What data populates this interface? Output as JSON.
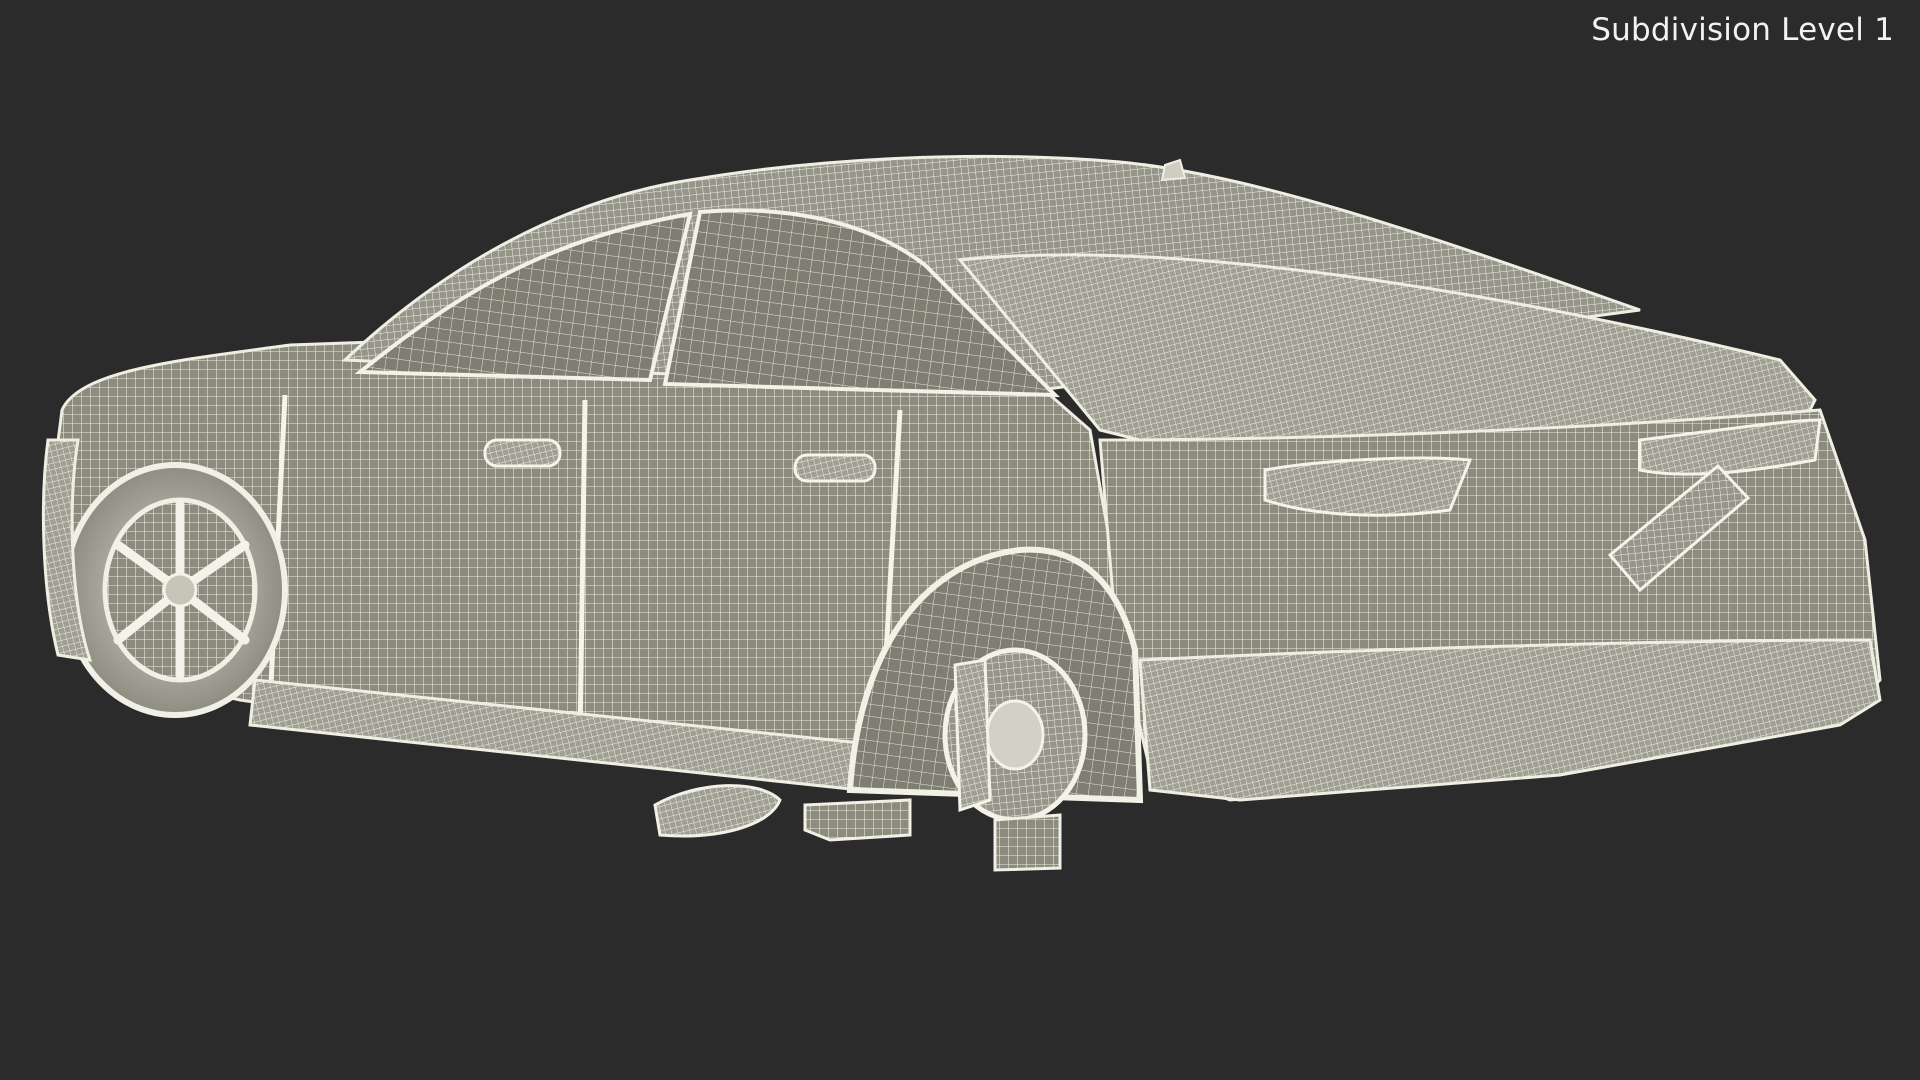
{
  "viewport": {
    "label": "Subdivision Level 1",
    "background_color": "#2b2b2b"
  },
  "model": {
    "mesh_fill_color": "#8a8a7c",
    "wire_color": "#ecebdf",
    "icon": "wireframe-car-icon"
  }
}
